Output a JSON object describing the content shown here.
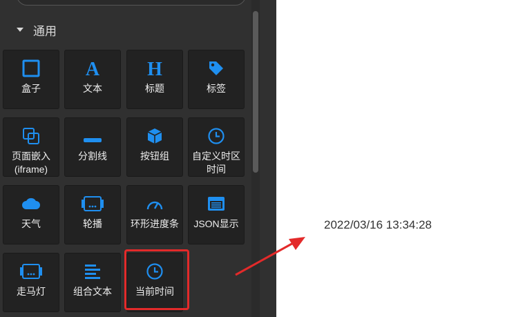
{
  "section": {
    "title": "通用"
  },
  "components": [
    {
      "label": "盒子",
      "icon": "square-icon"
    },
    {
      "label": "文本",
      "icon": "letter-a-icon"
    },
    {
      "label": "标题",
      "icon": "letter-h-icon"
    },
    {
      "label": "标签",
      "icon": "tag-icon"
    },
    {
      "label": "页面嵌入\n(iframe)",
      "icon": "embed-icon"
    },
    {
      "label": "分割线",
      "icon": "divider-icon"
    },
    {
      "label": "按钮组",
      "icon": "cube-icon"
    },
    {
      "label": "自定义时区\n时间",
      "icon": "clock-icon"
    },
    {
      "label": "天气",
      "icon": "cloud-icon"
    },
    {
      "label": "轮播",
      "icon": "carousel-icon"
    },
    {
      "label": "环形进度条",
      "icon": "gauge-icon"
    },
    {
      "label": "JSON显示",
      "icon": "json-window-icon"
    },
    {
      "label": "走马灯",
      "icon": "marquee-icon"
    },
    {
      "label": "组合文本",
      "icon": "align-left-icon"
    },
    {
      "label": "当前时间",
      "icon": "clock-icon"
    }
  ],
  "preview": {
    "time": "2022/03/16 13:34:28"
  },
  "colors": {
    "accent": "#1f8ff0",
    "highlight": "#e32a2a",
    "panel": "#303030",
    "tile": "#222222"
  }
}
